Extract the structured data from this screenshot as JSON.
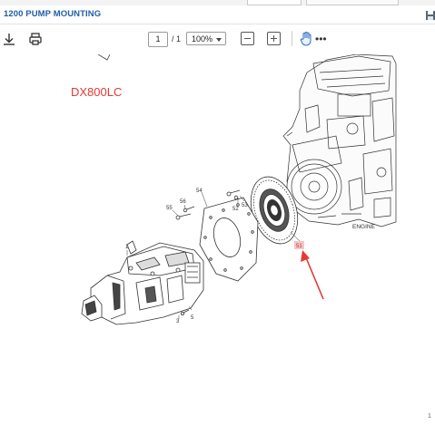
{
  "document": {
    "title": "1200 PUMP MOUNTING"
  },
  "toolbar": {
    "page_current": "1",
    "page_total": "/ 1",
    "zoom": "100%",
    "icons": [
      "download-icon",
      "print-icon",
      "zoom-out-icon",
      "zoom-in-icon",
      "hand-tool-icon",
      "more-options-icon"
    ]
  },
  "drawing": {
    "model_label": "DX800LC",
    "part_numbers": [
      "1",
      "3",
      "5",
      "51",
      "52",
      "53",
      "54",
      "55",
      "56"
    ],
    "engine_label": "ENGINE",
    "highlight_color": "#e53935",
    "highlighted_part": "51"
  },
  "page_marker": "1"
}
